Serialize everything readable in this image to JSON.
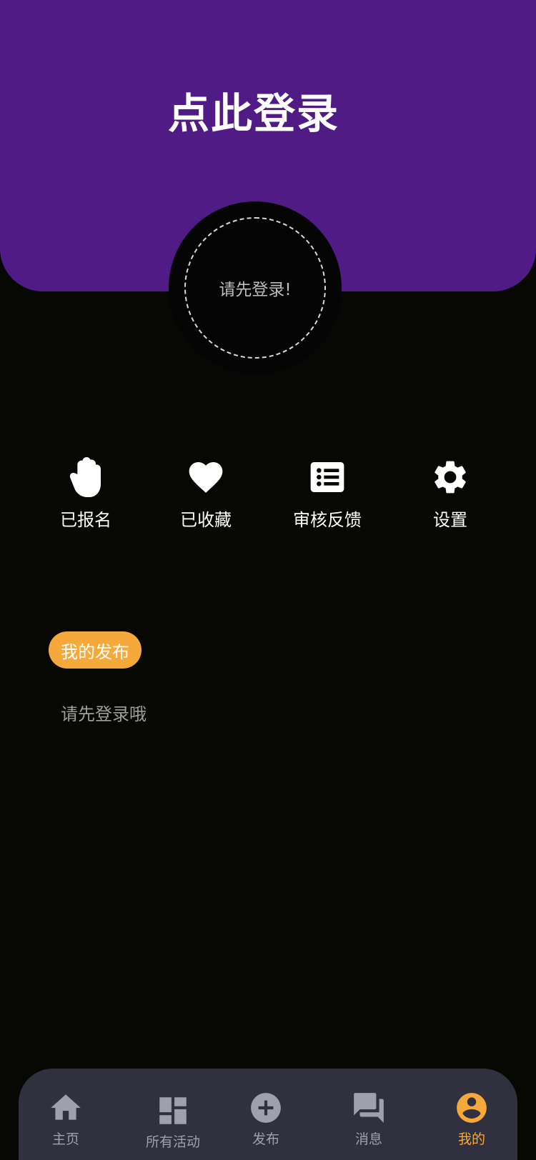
{
  "header": {
    "login_title": "点此登录",
    "avatar_prompt": "请先登录!"
  },
  "quick_actions": [
    {
      "label": "已报名",
      "icon": "hand-icon"
    },
    {
      "label": "已收藏",
      "icon": "heart-icon"
    },
    {
      "label": "审核反馈",
      "icon": "list-icon"
    },
    {
      "label": "设置",
      "icon": "gear-icon"
    }
  ],
  "section": {
    "tab_label": "我的发布",
    "empty_text": "请先登录哦"
  },
  "tabbar": {
    "items": [
      {
        "label": "主页",
        "icon": "home-icon"
      },
      {
        "label": "所有活动",
        "icon": "dashboard-icon"
      },
      {
        "label": "发布",
        "icon": "add-circle-icon"
      },
      {
        "label": "消息",
        "icon": "chat-icon"
      },
      {
        "label": "我的",
        "icon": "account-icon"
      }
    ],
    "active_index": 4
  },
  "colors": {
    "hero_bg": "#511b86",
    "page_bg": "#070704",
    "accent": "#f5a93a",
    "tabbar_bg": "#31303e",
    "tab_inactive": "#a0a0ad"
  }
}
